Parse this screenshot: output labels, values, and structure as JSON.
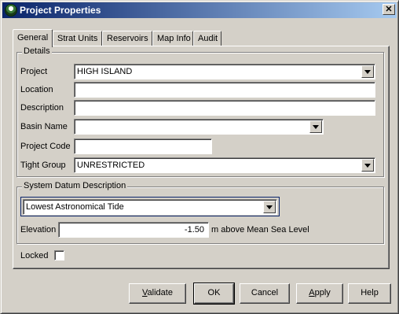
{
  "window": {
    "title": "Project Properties",
    "close": "✕"
  },
  "tabs": [
    {
      "label": "General"
    },
    {
      "label": "Strat Units"
    },
    {
      "label": "Reservoirs"
    },
    {
      "label": "Map Info"
    },
    {
      "label": "Audit"
    }
  ],
  "details": {
    "group_title": "Details",
    "project_label": "Project",
    "project_value": "HIGH ISLAND",
    "location_label": "Location",
    "location_value": "",
    "description_label": "Description",
    "description_value": "",
    "basin_label": "Basin Name",
    "basin_value": "",
    "project_code_label": "Project Code",
    "project_code_value": "",
    "tight_group_label": "Tight Group",
    "tight_group_value": "UNRESTRICTED"
  },
  "datum": {
    "group_title": "System Datum Description",
    "datum_value": "Lowest Astronomical Tide",
    "elevation_label": "Elevation",
    "elevation_value": "-1.50",
    "elevation_units": "m above Mean Sea Level"
  },
  "locked_label": "Locked",
  "buttons": {
    "validate": "Validate",
    "ok": "OK",
    "cancel": "Cancel",
    "apply": "Apply",
    "help": "Help"
  }
}
